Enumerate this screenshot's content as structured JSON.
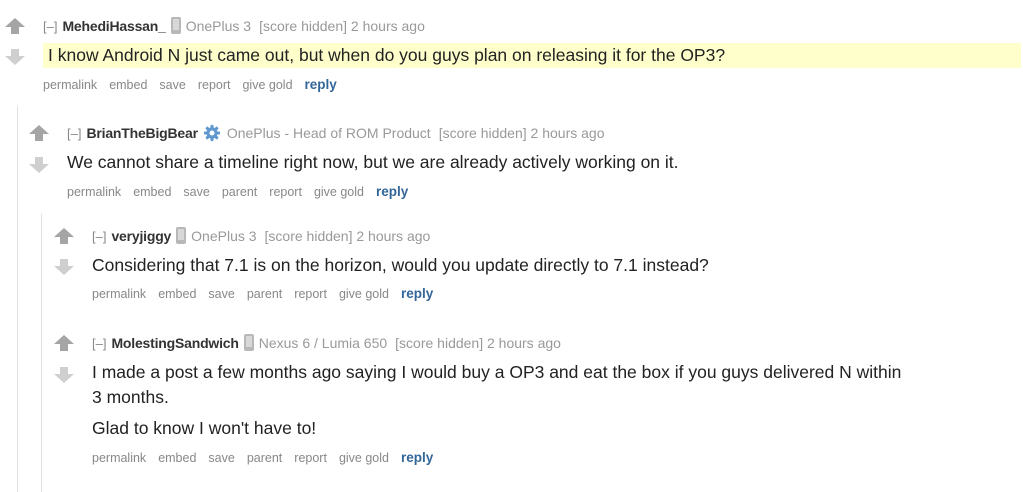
{
  "comments": [
    {
      "expand": "[–]",
      "author": "MehediHassan_",
      "flair": "OnePlus 3",
      "flair_icon": "phone-icon",
      "score": "[score hidden] 2 hours ago",
      "body": [
        "I know Android N just came out, but when do you guys plan on releasing it for the OP3?"
      ],
      "buttons": [
        "permalink",
        "embed",
        "save",
        "report",
        "give gold"
      ],
      "reply": "reply"
    },
    {
      "expand": "[–]",
      "author": "BrianTheBigBear",
      "flair": "OnePlus - Head of ROM Product",
      "flair_icon": "gear-icon",
      "score": "[score hidden] 2 hours ago",
      "body": [
        "We cannot share a timeline right now, but we are already actively working on it."
      ],
      "buttons": [
        "permalink",
        "embed",
        "save",
        "parent",
        "report",
        "give gold"
      ],
      "reply": "reply"
    },
    {
      "expand": "[–]",
      "author": "veryjiggy",
      "flair": "OnePlus 3",
      "flair_icon": "phone-icon",
      "score": "[score hidden] 2 hours ago",
      "body": [
        "Considering that 7.1 is on the horizon, would you update directly to 7.1 instead?"
      ],
      "buttons": [
        "permalink",
        "embed",
        "save",
        "parent",
        "report",
        "give gold"
      ],
      "reply": "reply"
    },
    {
      "expand": "[–]",
      "author": "MolestingSandwich",
      "flair": "Nexus 6 / Lumia 650",
      "flair_icon": "phone-icon",
      "score": "[score hidden] 2 hours ago",
      "body": [
        "I made a post a few months ago saying I would buy a OP3 and eat the box if you guys delivered N within",
        "3 months.",
        "Glad to know I won't have to!"
      ],
      "buttons": [
        "permalink",
        "embed",
        "save",
        "parent",
        "report",
        "give gold"
      ],
      "reply": "reply"
    }
  ],
  "colors": {
    "highlight": "#ffffcc",
    "reply": "#336699",
    "upvote": "#a5a5a5",
    "downvote": "#cfcfcf",
    "gear": "#5f99cf"
  }
}
